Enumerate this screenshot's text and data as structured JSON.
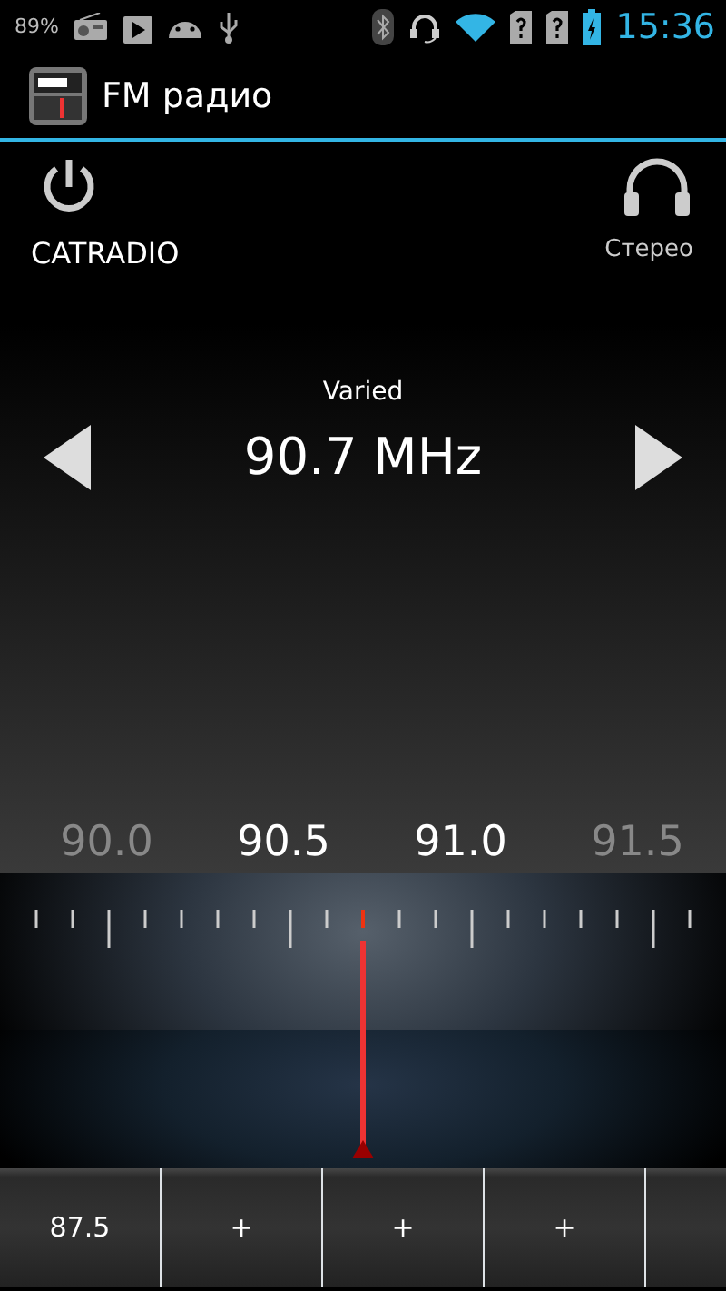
{
  "status_bar": {
    "battery_percent": "89%",
    "time": "15:36"
  },
  "app_bar": {
    "title": "FM радио"
  },
  "station": {
    "name": "CATRADIO",
    "audio_mode": "Стерео",
    "program": "Varied",
    "frequency": "90.7 MHz"
  },
  "scale_labels": [
    {
      "label": "90.0",
      "faded": true
    },
    {
      "label": "90.5",
      "faded": false
    },
    {
      "label": "91.0",
      "faded": false
    },
    {
      "label": "91.5",
      "faded": true
    }
  ],
  "presets": [
    {
      "label": "87.5"
    },
    {
      "label": "+"
    },
    {
      "label": "+"
    },
    {
      "label": "+"
    }
  ]
}
